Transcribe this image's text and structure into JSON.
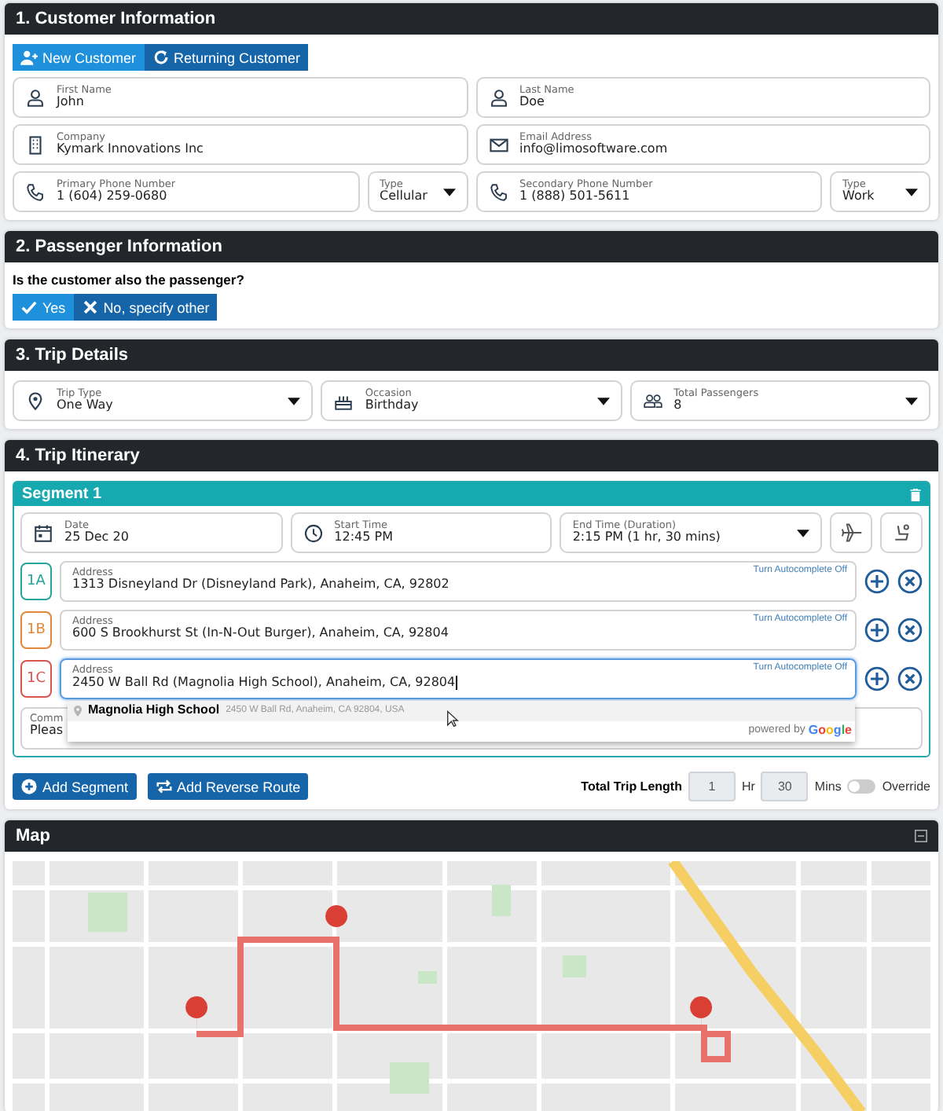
{
  "customer_information": {
    "title": "1. Customer Information",
    "customer_buttons": [
      {
        "label": "New Customer",
        "kind": "add-person",
        "selected": true
      },
      {
        "label": "Returning Customer",
        "kind": "refresh",
        "selected": false
      }
    ],
    "rows": [
      [
        {
          "kind": "person",
          "label": "First Name",
          "value": "John"
        },
        {
          "kind": "person",
          "label": "Last Name",
          "value": "Doe"
        }
      ],
      [
        {
          "kind": "company",
          "label": "Company",
          "value": "Kymark Innovations Inc"
        },
        {
          "kind": "email",
          "label": "Email Address",
          "value": "info@limosoftware.com"
        }
      ],
      [
        {
          "kind": "phone",
          "label": "Primary Phone Number",
          "value": "1 (604) 259-0680"
        },
        {
          "kind": "select",
          "label": "Type",
          "value": "Cellular"
        },
        {
          "kind": "phone",
          "label": "Secondary Phone Number",
          "value": "1 (888) 501-5611"
        },
        {
          "kind": "select",
          "label": "Type",
          "value": "Work"
        }
      ]
    ]
  },
  "passenger_information": {
    "title": "2. Passenger Information",
    "question": "Is the customer also the passenger?",
    "buttons": [
      {
        "label": "Yes",
        "kind": "check",
        "selected": true
      },
      {
        "label": "No, specify other",
        "kind": "cross",
        "selected": false
      }
    ]
  },
  "trip_details": {
    "title": "3. Trip Details",
    "fields": [
      {
        "kind": "pin",
        "label": "Trip Type",
        "value": "One Way"
      },
      {
        "kind": "cake",
        "label": "Occasion",
        "value": "Birthday"
      },
      {
        "kind": "people",
        "label": "Total Passengers",
        "value": "8"
      }
    ]
  },
  "trip_itinerary": {
    "title": "4. Trip Itinerary",
    "segment": {
      "title": "Segment 1",
      "time_fields": [
        {
          "kind": "calendar",
          "label": "Date",
          "value": "25 Dec 20"
        },
        {
          "kind": "clock",
          "label": "Start Time",
          "value": "12:45 PM"
        },
        {
          "kind": "select",
          "label": "End Time (Duration)",
          "value": "2:15 PM (1 hr, 30 mins)"
        }
      ],
      "stops": [
        {
          "code": "1A",
          "color": "#26a69a",
          "label": "Address",
          "value": "1313 Disneyland Dr (Disneyland Park), Anaheim, CA, 92802",
          "link": "Turn Autocomplete Off",
          "focused": false
        },
        {
          "code": "1B",
          "color": "#e0873a",
          "label": "Address",
          "value": "600 S Brookhurst St (In-N-Out Burger), Anaheim, CA, 92804",
          "link": "Turn Autocomplete Off",
          "focused": false
        },
        {
          "code": "1C",
          "color": "#d9534f",
          "label": "Address",
          "value": "2450 W Ball Rd (Magnolia High School), Anaheim, CA, 92804",
          "link": "Turn Autocomplete Off",
          "focused": true
        }
      ],
      "suggestion": {
        "name": "Magnolia High School",
        "detail": "2450 W Ball Rd, Anaheim, CA 92804, USA",
        "powered_by": "powered by",
        "brand": "Google"
      },
      "comments": {
        "label": "Comm",
        "value": "Pleas"
      }
    },
    "buttons": [
      {
        "label": "Add Segment",
        "kind": "plus"
      },
      {
        "label": "Add Reverse Route",
        "kind": "repeat"
      }
    ],
    "trip_length": {
      "label": "Total Trip Length",
      "hours": "1",
      "hours_unit": "Hr",
      "minutes": "30",
      "minutes_unit": "Mins",
      "override": {
        "label": "Override",
        "on": false
      }
    }
  },
  "map": {
    "title": "Map"
  }
}
